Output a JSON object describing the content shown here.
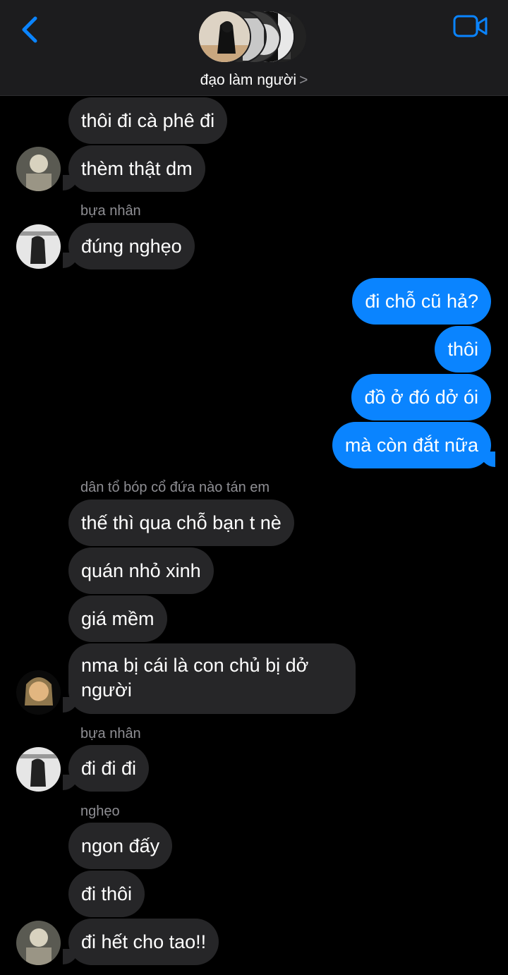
{
  "header": {
    "title": "đạo làm người",
    "title_chevron": ">",
    "back_icon": "chevron-left-icon",
    "video_icon": "video-camera-icon",
    "accent": "#0a84ff"
  },
  "messages": [
    {
      "side": "in",
      "text": "thôi đi cà phê đi"
    },
    {
      "side": "in",
      "text": "thèm thật dm"
    },
    {
      "side": "in",
      "sender": "bựa nhân",
      "text": "đúng nghẹo"
    },
    {
      "side": "out",
      "text": "đi chỗ cũ hả?"
    },
    {
      "side": "out",
      "text": "thôi"
    },
    {
      "side": "out",
      "text": "đồ ở đó dở ói"
    },
    {
      "side": "out",
      "text": "mà còn đắt nữa"
    },
    {
      "side": "in",
      "sender": "dân tổ bóp cổ đứa nào tán em",
      "text": "thế thì qua chỗ bạn t nè"
    },
    {
      "side": "in",
      "text": "quán nhỏ xinh"
    },
    {
      "side": "in",
      "text": "giá mềm"
    },
    {
      "side": "in",
      "text": "nma bị cái là con chủ bị dở người"
    },
    {
      "side": "in",
      "sender": "bựa nhân",
      "text": "đi đi đi"
    },
    {
      "side": "in",
      "sender": "nghẹo",
      "text": "ngon đấy"
    },
    {
      "side": "in",
      "text": "đi thôi"
    },
    {
      "side": "in",
      "text": "đi hết cho tao!!"
    }
  ],
  "colors": {
    "incoming_bubble": "#262628",
    "outgoing_bubble": "#0a84ff",
    "header_bg": "#1c1c1e",
    "sender_label": "#8e8e93"
  }
}
